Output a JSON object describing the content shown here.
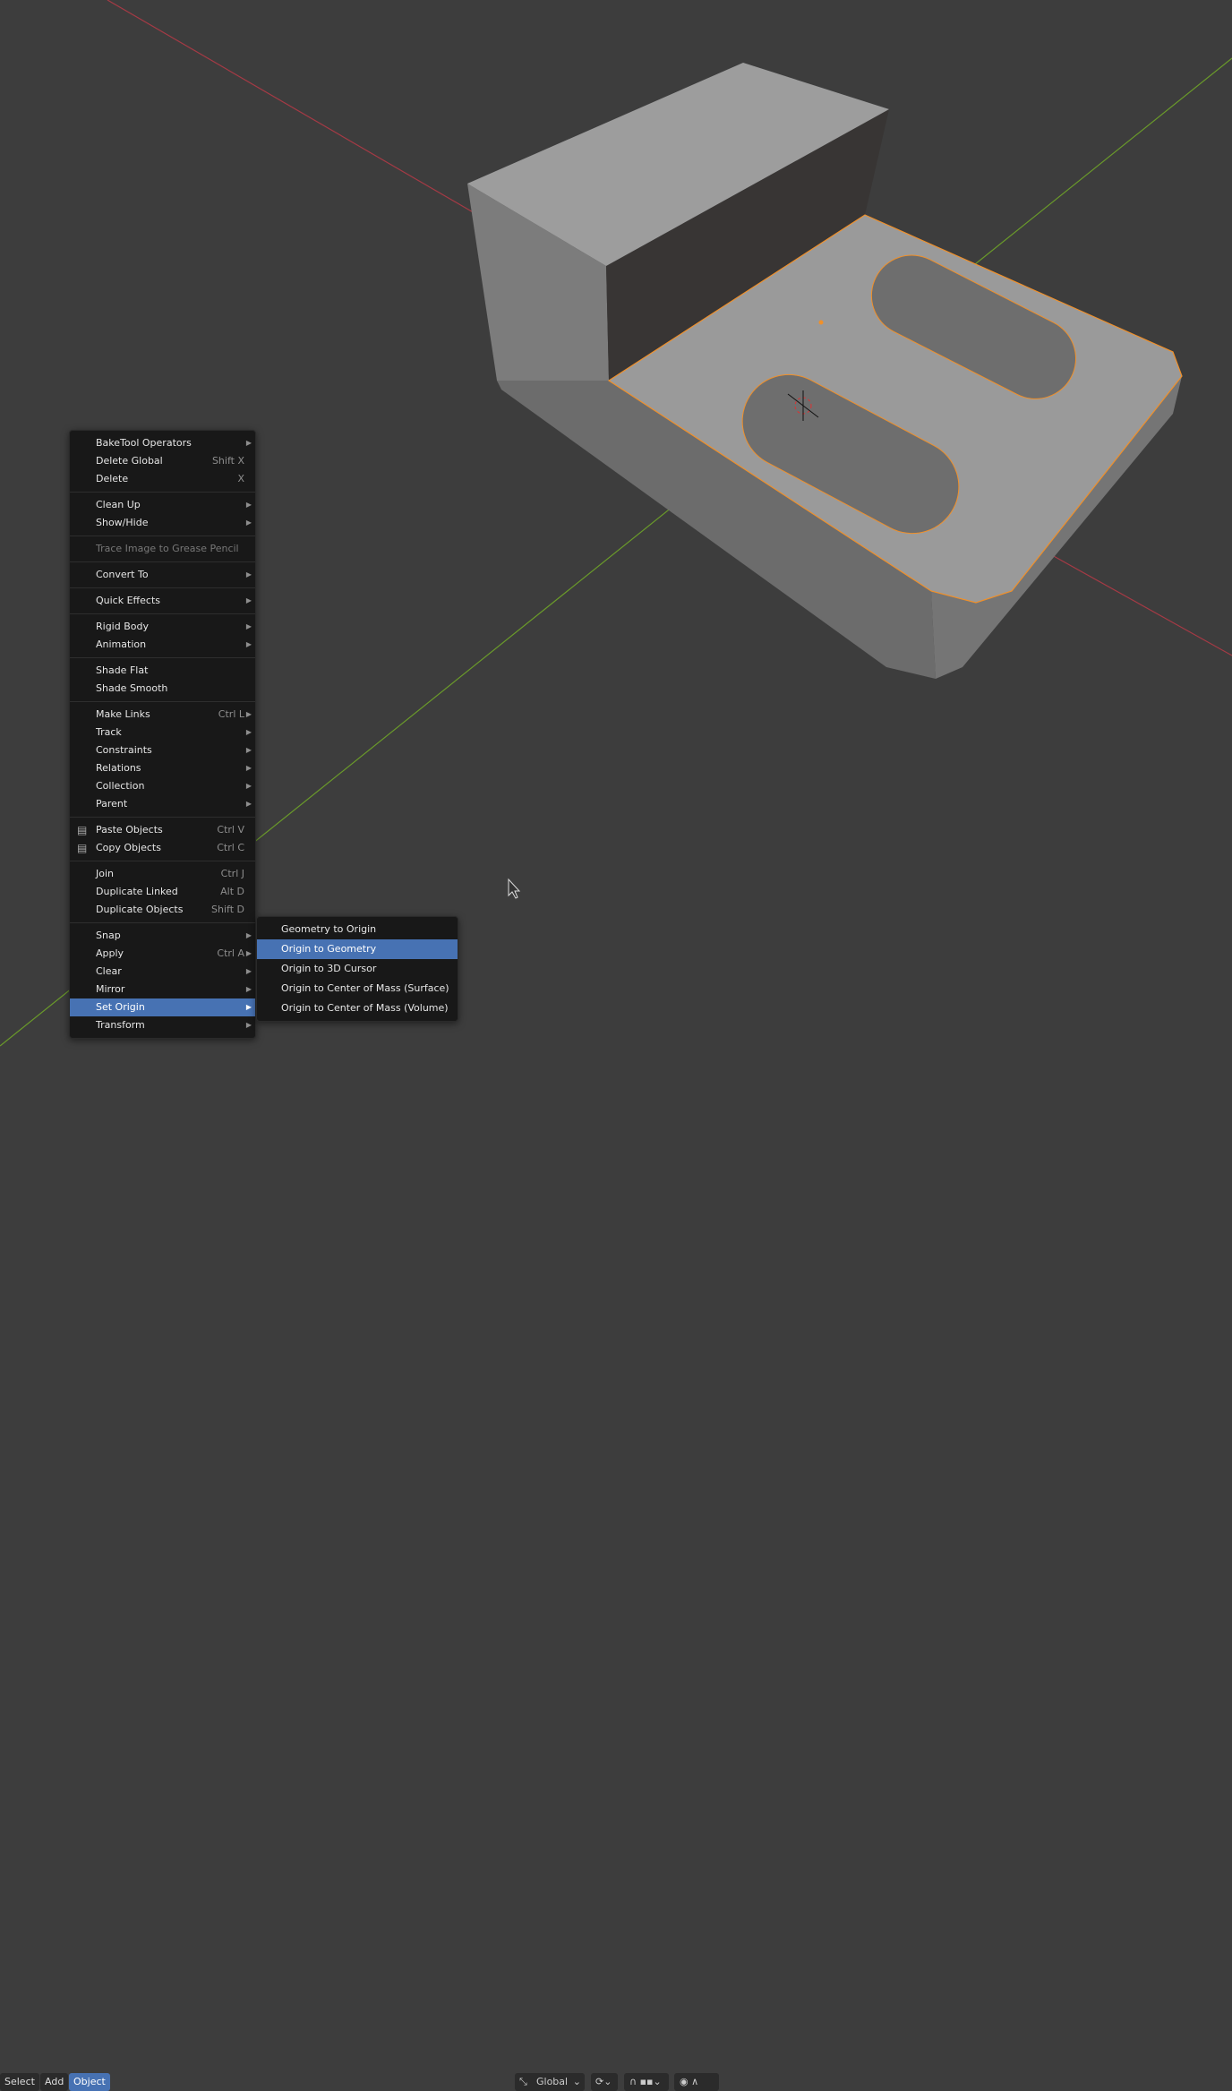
{
  "colors": {
    "accent": "#4772b3",
    "background": "#3d3d3d",
    "menu": "#181818",
    "x_axis": "#a53a45",
    "y_axis": "#6a9a2a",
    "selection_outline": "#f0902a"
  },
  "menu": {
    "sections": [
      [
        {
          "label": "BakeTool Operators",
          "submenu": true
        },
        {
          "label": "Delete Global",
          "shortcut": "Shift X"
        },
        {
          "label": "Delete",
          "shortcut": "X"
        }
      ],
      [
        {
          "label": "Clean Up",
          "submenu": true
        },
        {
          "label": "Show/Hide",
          "submenu": true
        }
      ],
      [
        {
          "label": "Trace Image to Grease Pencil",
          "disabled": true
        }
      ],
      [
        {
          "label": "Convert To",
          "submenu": true
        }
      ],
      [
        {
          "label": "Quick Effects",
          "submenu": true
        }
      ],
      [
        {
          "label": "Rigid Body",
          "submenu": true
        },
        {
          "label": "Animation",
          "submenu": true
        }
      ],
      [
        {
          "label": "Shade Flat"
        },
        {
          "label": "Shade Smooth"
        }
      ],
      [
        {
          "label": "Make Links",
          "shortcut": "Ctrl L",
          "submenu": true
        },
        {
          "label": "Track",
          "submenu": true
        },
        {
          "label": "Constraints",
          "submenu": true
        },
        {
          "label": "Relations",
          "submenu": true
        },
        {
          "label": "Collection",
          "submenu": true
        },
        {
          "label": "Parent",
          "submenu": true
        }
      ],
      [
        {
          "label": "Paste Objects",
          "shortcut": "Ctrl V",
          "icon": "paste-icon"
        },
        {
          "label": "Copy Objects",
          "shortcut": "Ctrl C",
          "icon": "copy-icon"
        }
      ],
      [
        {
          "label": "Join",
          "shortcut": "Ctrl J"
        },
        {
          "label": "Duplicate Linked",
          "shortcut": "Alt D"
        },
        {
          "label": "Duplicate Objects",
          "shortcut": "Shift D"
        }
      ],
      [
        {
          "label": "Snap",
          "submenu": true
        },
        {
          "label": "Apply",
          "shortcut": "Ctrl A",
          "submenu": true
        },
        {
          "label": "Clear",
          "submenu": true
        },
        {
          "label": "Mirror",
          "submenu": true
        },
        {
          "label": "Set Origin",
          "submenu": true,
          "active": true
        },
        {
          "label": "Transform",
          "submenu": true
        }
      ]
    ]
  },
  "submenu": {
    "items": [
      {
        "label": "Geometry to Origin"
      },
      {
        "label": "Origin to Geometry",
        "active": true
      },
      {
        "label": "Origin to 3D Cursor"
      },
      {
        "label": "Origin to Center of Mass (Surface)"
      },
      {
        "label": "Origin to Center of Mass (Volume)"
      }
    ]
  },
  "header": {
    "select": "Select",
    "add": "Add",
    "object": "Object",
    "transform_orientation": "Global"
  }
}
